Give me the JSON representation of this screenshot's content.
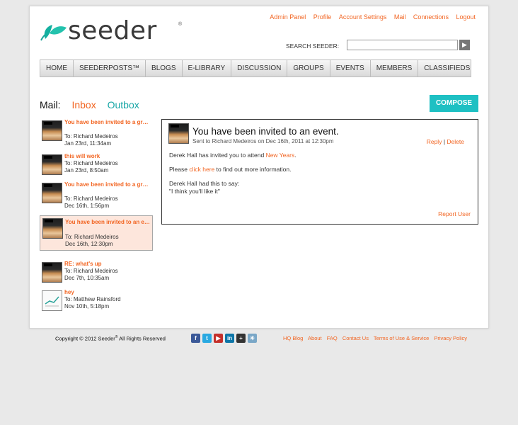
{
  "top_links": [
    "Admin Panel",
    "Profile",
    "Account Settings",
    "Mail",
    "Connections",
    "Logout"
  ],
  "logo": {
    "text": "seeder",
    "reg": "®"
  },
  "search": {
    "label": "SEARCH SEEDER:",
    "value": "",
    "button_icon": "arrow-right-icon"
  },
  "nav": [
    "HOME",
    "SEEDERPOSTS™",
    "BLOGS",
    "E-LIBRARY",
    "DISCUSSION",
    "GROUPS",
    "EVENTS",
    "MEMBERS",
    "CLASSIFIEDS"
  ],
  "mail": {
    "label": "Mail:",
    "inbox": "Inbox",
    "outbox": "Outbox",
    "compose": "COMPOSE"
  },
  "messages": [
    {
      "subject": "You have been invited to a gr…",
      "to": "To: Richard Medeiros",
      "date": "Jan 23rd, 11:34am"
    },
    {
      "subject": "this will work",
      "to": "To: Richard Medeiros",
      "date": "Jan 23rd, 8:50am"
    },
    {
      "subject": "You have been invited to a gr…",
      "to": "To: Richard Medeiros",
      "date": "Dec 16th, 1:56pm"
    },
    {
      "subject": "You have been invited to an e…",
      "to": "To: Richard Medeiros",
      "date": "Dec 16th, 12:30pm"
    },
    {
      "subject": "RE: what's up",
      "to": "To: Richard Medeiros",
      "date": "Dec 7th, 10:35am"
    },
    {
      "subject": "hey",
      "to": "To: Matthew Rainsford",
      "date": "Nov 10th, 5:18pm"
    }
  ],
  "detail": {
    "title": "You have been invited to an event.",
    "sent": "Sent to Richard Medeiros on Dec 16th, 2011 at 12:30pm",
    "reply": "Reply",
    "separator": "|",
    "delete": "Delete",
    "line1_prefix": "Derek Hall has invited you to attend ",
    "line1_link": "New Years",
    "line1_suffix": ".",
    "line2_prefix": "Please ",
    "line2_link": "click here",
    "line2_suffix": " to find out more information.",
    "line3": "Derek Hall had this to say:",
    "line4": "\"I think you'll like it\"",
    "report": "Report User"
  },
  "footer": {
    "copyright": "Copyright © 2012 Seeder",
    "copyright_reg": "®",
    "copyright_suffix": " All Rights Reserved",
    "social": [
      {
        "icon": "facebook-icon",
        "glyph": "f",
        "color": "#3b5998"
      },
      {
        "icon": "twitter-icon",
        "glyph": "t",
        "color": "#29a9e1"
      },
      {
        "icon": "youtube-icon",
        "glyph": "▶",
        "color": "#c4302b"
      },
      {
        "icon": "linkedin-icon",
        "glyph": "in",
        "color": "#0e76a8"
      },
      {
        "icon": "plus-icon",
        "glyph": "+",
        "color": "#333333"
      },
      {
        "icon": "share-icon",
        "glyph": "✳",
        "color": "#7aa7c7"
      }
    ],
    "links": [
      "HQ Blog",
      "About",
      "FAQ",
      "Contact Us",
      "Terms of Use & Service",
      "Privacy Policy"
    ]
  }
}
